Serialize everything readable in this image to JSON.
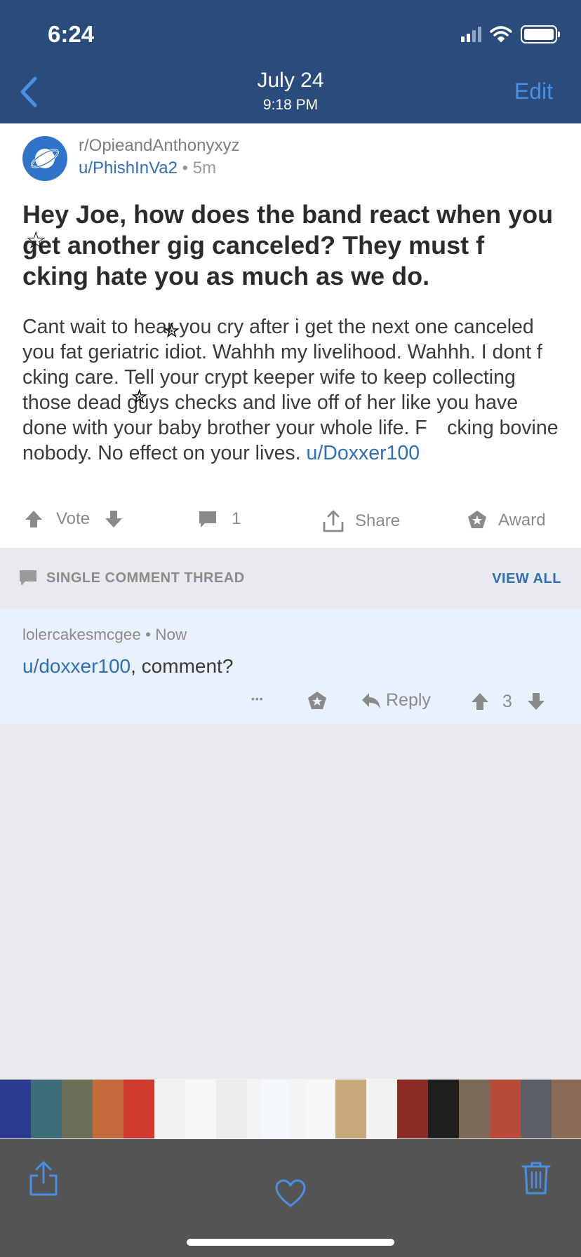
{
  "status": {
    "time": "6:24"
  },
  "nav": {
    "date": "July 24",
    "time": "9:18 PM",
    "edit": "Edit"
  },
  "post": {
    "subreddit": "r/OpieandAnthonyxyz",
    "author": "u/PhishInVa2",
    "separator": " • ",
    "age": "5m",
    "title": "Hey Joe, how does the band react when you get another gig canceled? They must f cking hate you as much as we do.",
    "body": "Cant wait to hear you cry after i get the next one canceled you fat geriatric idiot. Wahhh my livelihood. Wahhh. I dont f cking care. Tell your crypt keeper wife to keep collecting those dead guys checks and live off of her like you have done with your baby brother your whole life. F cking bovine nobody. No effect on your lives. ",
    "body_link": "u/Doxxer100",
    "vote_label": "Vote",
    "comment_count": "1",
    "share_label": "Share",
    "award_label": "Award"
  },
  "thread": {
    "title": "SINGLE COMMENT THREAD",
    "view_all": "VIEW ALL"
  },
  "comment": {
    "author": "lolercakesmcgee",
    "separator": " • ",
    "age": "Now",
    "mention": "u/doxxer100",
    "text": ", comment?",
    "more": "•••",
    "reply_label": "Reply",
    "score": "3"
  },
  "colors": {
    "header_bg": "#2a4c7c",
    "accent": "#4a90e2",
    "link": "#2f6fb5",
    "toolbar_bg": "#545454",
    "comment_bg": "#e9f2fc"
  },
  "icons": [
    "back-chevron-icon",
    "signal-icon",
    "wifi-icon",
    "battery-icon",
    "planet-icon",
    "upvote-icon",
    "downvote-icon",
    "comment-icon",
    "share-icon",
    "award-icon",
    "more-icon",
    "reply-icon",
    "heart-icon",
    "trash-icon"
  ],
  "filmstrip_thumbs": [
    "#2b3b8f",
    "#3d6d7a",
    "#6b6f58",
    "#c46a3c",
    "#d03a2c",
    "#f2f2f2",
    "#f7f7f7",
    "#ececec",
    "#f4f7fb",
    "#f7f7f7",
    "#c9a77b",
    "#f2f2f2",
    "#8b2c22",
    "#1e1e1e",
    "#7a6a55",
    "#b84a3a",
    "#5a5f66",
    "#8b6a55"
  ]
}
